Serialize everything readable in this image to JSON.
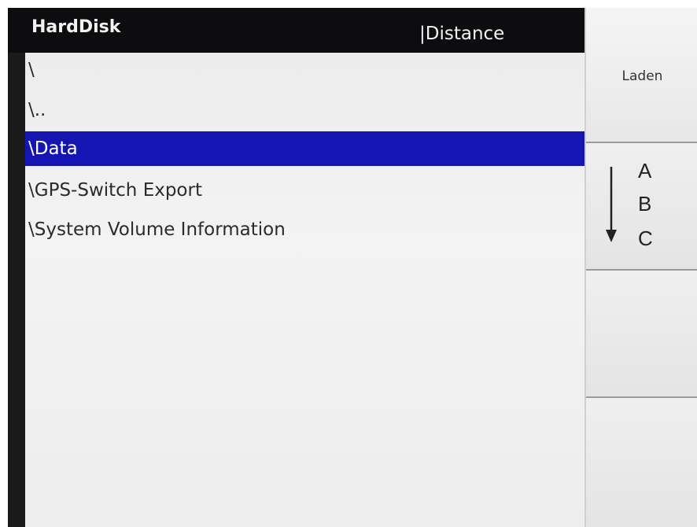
{
  "header": {
    "title": "HardDisk",
    "column": "|Distance"
  },
  "files": [
    {
      "name": "\\",
      "selected": false
    },
    {
      "name": "\\..",
      "selected": false
    },
    {
      "name": "\\Data",
      "selected": true
    },
    {
      "name": "\\GPS-Switch Export",
      "selected": false
    },
    {
      "name": "\\System Volume Information",
      "selected": false
    }
  ],
  "sidebar": {
    "load_label": "Laden",
    "sort_letters": [
      "A",
      "B",
      "C"
    ]
  },
  "colors": {
    "selection": "#1515b4",
    "header_bg": "#0d0d0f"
  }
}
